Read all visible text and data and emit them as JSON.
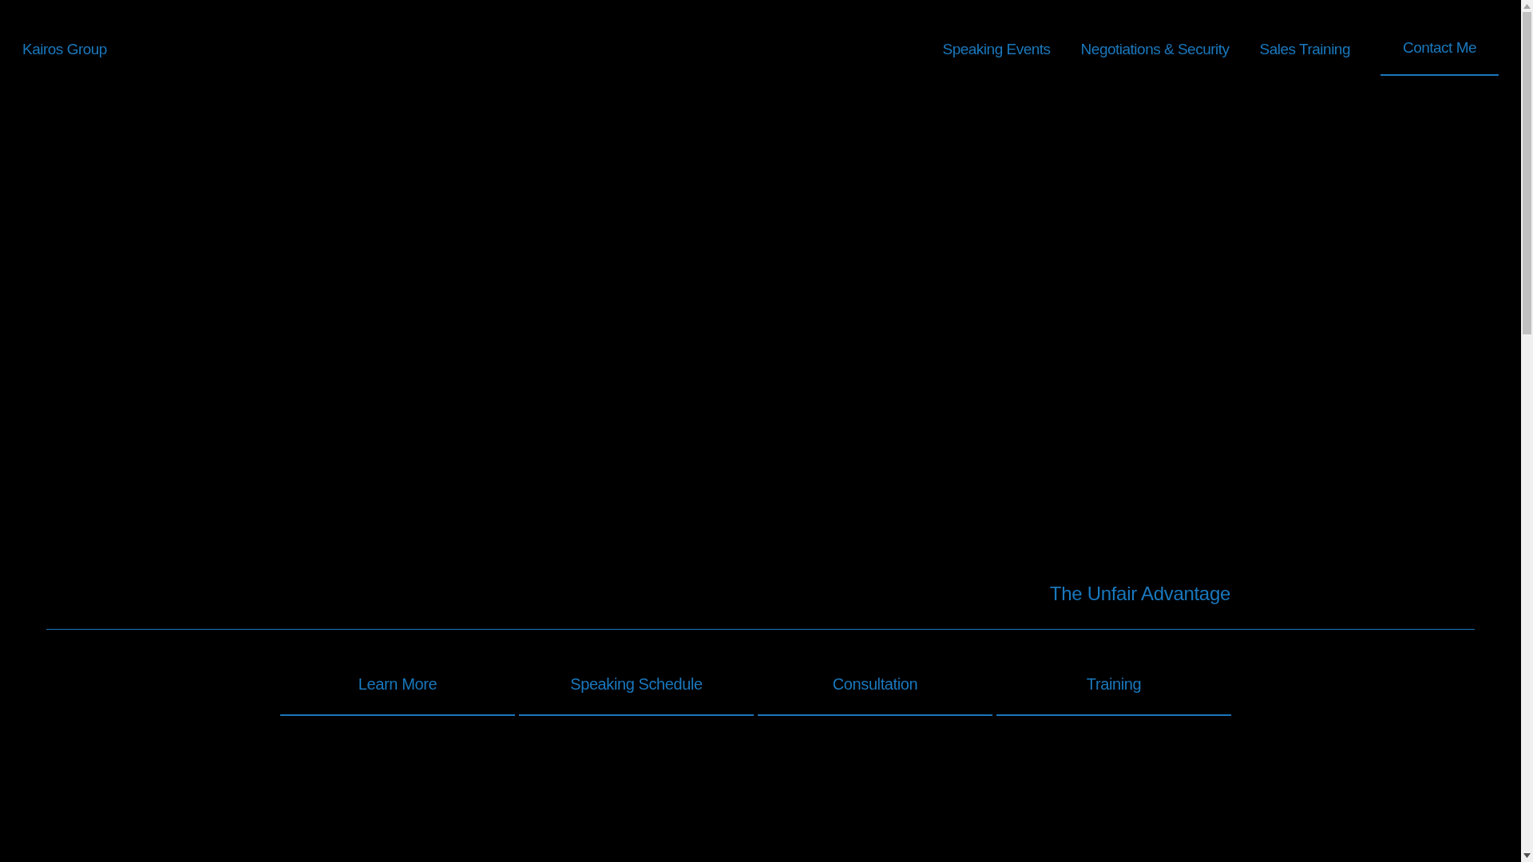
{
  "header": {
    "logo": "Kairos Group",
    "nav": [
      {
        "label": "Speaking Events",
        "selected": false
      },
      {
        "label": "Negotiations & Security",
        "selected": false
      },
      {
        "label": "Sales Training",
        "selected": false
      },
      {
        "label": "Contact Me",
        "selected": true
      }
    ]
  },
  "hero": {
    "tagline": "The Unfair Advantage"
  },
  "links": [
    "Learn More",
    "Speaking Schedule",
    "Consultation",
    "Training"
  ]
}
